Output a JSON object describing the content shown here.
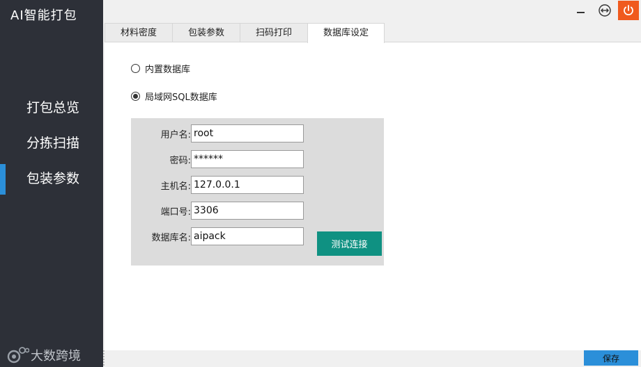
{
  "app": {
    "title": "AI智能打包"
  },
  "sidebar": {
    "items": [
      {
        "label": "打包总览"
      },
      {
        "label": "分拣扫描"
      },
      {
        "label": "包装参数"
      }
    ],
    "active_index": 2,
    "brand": "大数跨境"
  },
  "window_controls": [
    "minimize-icon",
    "resize-icon",
    "power-icon"
  ],
  "tabs": [
    {
      "label": "材料密度"
    },
    {
      "label": "包装参数"
    },
    {
      "label": "扫码打印"
    },
    {
      "label": "数据库设定"
    }
  ],
  "active_tab": 3,
  "db_options": [
    {
      "label": "内置数据库",
      "checked": false
    },
    {
      "label": "局域网SQL数据库",
      "checked": true
    }
  ],
  "form": {
    "username": {
      "label": "用户名:",
      "value": "root"
    },
    "password": {
      "label": "密码:",
      "value": "******"
    },
    "host": {
      "label": "主机名:",
      "value": "127.0.0.1"
    },
    "port": {
      "label": "端口号:",
      "value": "3306"
    },
    "database": {
      "label": "数据库名:",
      "value": "aipack"
    }
  },
  "buttons": {
    "test_connection": "测试连接",
    "save": "保存"
  },
  "colors": {
    "sidebar_bg": "#2d3038",
    "accent": "#2b8fd9",
    "test_button": "#0f9182",
    "power_button": "#f05a1e"
  }
}
